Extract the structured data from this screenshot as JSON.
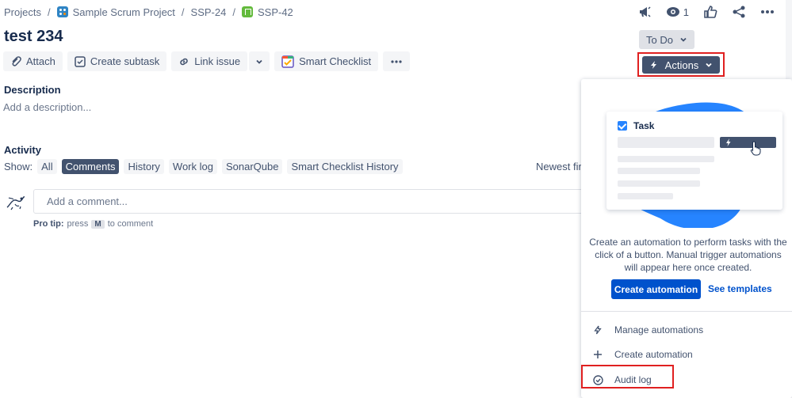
{
  "breadcrumb": {
    "projects": "Projects",
    "project": "Sample Scrum Project",
    "epic": "SSP-24",
    "issue": "SSP-42",
    "separator": "/"
  },
  "header": {
    "watch_count": "1",
    "icons": [
      "megaphone-icon",
      "eye-icon",
      "thumbs-up-icon",
      "share-icon",
      "more-icon"
    ]
  },
  "issue": {
    "title": "test 234"
  },
  "toolbar": {
    "attach": "Attach",
    "create_subtask": "Create subtask",
    "link_issue": "Link issue",
    "smart_checklist": "Smart Checklist"
  },
  "status": {
    "label": "To Do",
    "actions_label": "Actions"
  },
  "description": {
    "label": "Description",
    "placeholder": "Add a description..."
  },
  "activity": {
    "label": "Activity",
    "show_label": "Show:",
    "filters": [
      "All",
      "Comments",
      "History",
      "Work log",
      "SonarQube",
      "Smart Checklist History"
    ],
    "active_filter": "Comments",
    "sort_label": "Newest first"
  },
  "comment": {
    "placeholder": "Add a comment...",
    "protip_prefix": "Pro tip:",
    "protip_press": "press",
    "protip_key": "M",
    "protip_suffix": "to comment"
  },
  "actions_panel": {
    "illustration_title": "Task",
    "empty_text": "Create an automation to perform tasks with the click of a button. Manual trigger automations will appear here once created.",
    "create_button": "Create automation",
    "see_templates": "See templates",
    "menu": [
      {
        "label": "Manage automations",
        "icon": "bolt-icon"
      },
      {
        "label": "Create automation",
        "icon": "plus-icon"
      },
      {
        "label": "Audit log",
        "icon": "check-circle-icon"
      }
    ]
  },
  "colors": {
    "primary": "#0052cc",
    "dark_button": "#42526e",
    "highlight": "#e02020",
    "blob": "#2684ff"
  }
}
